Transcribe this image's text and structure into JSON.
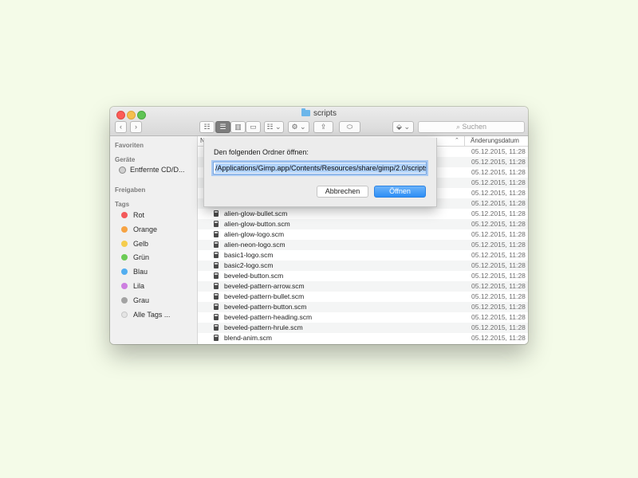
{
  "window": {
    "title": "scripts",
    "toolbar": {
      "back_icon": "‹",
      "forward_icon": "›",
      "view_icon": "☷",
      "view_list_icon": "☰",
      "view_columns_icon": "▥",
      "view_coverflow_icon": "▭",
      "arrange_icon": "☷ ⌄",
      "action_icon": "⚙ ⌄",
      "share_icon": "⇪",
      "tag_icon": "⬭",
      "dropbox_icon": "⬙ ⌄",
      "search_placeholder": "⌕ Suchen"
    }
  },
  "sidebar": {
    "favorites_header": "Favoriten",
    "devices_header": "Geräte",
    "device_item": "Entfernte CD/D...",
    "shared_header": "Freigaben",
    "tags_header": "Tags",
    "tags": [
      {
        "label": "Rot",
        "color": "#f3595a"
      },
      {
        "label": "Orange",
        "color": "#f6a343"
      },
      {
        "label": "Gelb",
        "color": "#f5cd4d"
      },
      {
        "label": "Grün",
        "color": "#6bcb54"
      },
      {
        "label": "Blau",
        "color": "#52aef0"
      },
      {
        "label": "Lila",
        "color": "#cd7fe0"
      },
      {
        "label": "Grau",
        "color": "#a3a3a3"
      }
    ],
    "all_tags": "Alle Tags ..."
  },
  "list": {
    "col_name": "N",
    "col_date": "Änderungsdatum",
    "sort_arrow": "⌃",
    "files": [
      {
        "name": "",
        "date": "05.12.2015, 11:28"
      },
      {
        "name": "",
        "date": "05.12.2015, 11:28"
      },
      {
        "name": "",
        "date": "05.12.2015, 11:28"
      },
      {
        "name": "",
        "date": "05.12.2015, 11:28"
      },
      {
        "name": "",
        "date": "05.12.2015, 11:28"
      },
      {
        "name": "alien-glow-bar.scm",
        "date": "05.12.2015, 11:28"
      },
      {
        "name": "alien-glow-bullet.scm",
        "date": "05.12.2015, 11:28"
      },
      {
        "name": "alien-glow-button.scm",
        "date": "05.12.2015, 11:28"
      },
      {
        "name": "alien-glow-logo.scm",
        "date": "05.12.2015, 11:28"
      },
      {
        "name": "alien-neon-logo.scm",
        "date": "05.12.2015, 11:28"
      },
      {
        "name": "basic1-logo.scm",
        "date": "05.12.2015, 11:28"
      },
      {
        "name": "basic2-logo.scm",
        "date": "05.12.2015, 11:28"
      },
      {
        "name": "beveled-button.scm",
        "date": "05.12.2015, 11:28"
      },
      {
        "name": "beveled-pattern-arrow.scm",
        "date": "05.12.2015, 11:28"
      },
      {
        "name": "beveled-pattern-bullet.scm",
        "date": "05.12.2015, 11:28"
      },
      {
        "name": "beveled-pattern-button.scm",
        "date": "05.12.2015, 11:28"
      },
      {
        "name": "beveled-pattern-heading.scm",
        "date": "05.12.2015, 11:28"
      },
      {
        "name": "beveled-pattern-hrule.scm",
        "date": "05.12.2015, 11:28"
      },
      {
        "name": "blend-anim.scm",
        "date": "05.12.2015, 11:28"
      }
    ]
  },
  "dialog": {
    "label": "Den folgenden Ordner öffnen:",
    "path_value": "/Applications/Gimp.app/Contents/Resources/share/gimp/2.0/scripts",
    "cancel_label": "Abbrechen",
    "open_label": "Öffnen"
  }
}
